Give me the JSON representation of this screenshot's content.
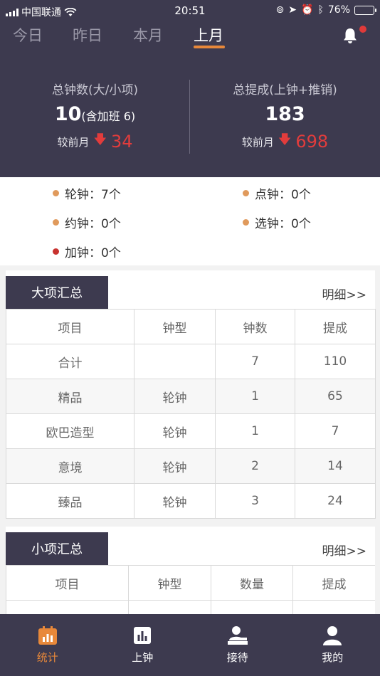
{
  "status_bar": {
    "carrier": "中国联通",
    "time": "20:51",
    "battery": "76%"
  },
  "tabs": [
    {
      "label": "今日"
    },
    {
      "label": "昨日"
    },
    {
      "label": "本月"
    },
    {
      "label": "上月"
    }
  ],
  "active_tab": "上月",
  "summary": {
    "left": {
      "label": "总钟数(大/小项)",
      "value": "10",
      "value_note": "(含加班 6)",
      "compare_label": "较前月",
      "compare_value": "34",
      "direction": "down"
    },
    "right": {
      "label": "总提成(上钟+推销)",
      "value": "183",
      "compare_label": "较前月",
      "compare_value": "698",
      "direction": "down"
    }
  },
  "clock_types": [
    {
      "label": "轮钟：7个",
      "color": "#e09a5c"
    },
    {
      "label": "点钟：0个",
      "color": "#e09a5c"
    },
    {
      "label": "约钟：0个",
      "color": "#e09a5c"
    },
    {
      "label": "选钟：0个",
      "color": "#e09a5c"
    },
    {
      "label": "加钟：0个",
      "color": "#c8322f"
    }
  ],
  "major": {
    "title": "大项汇总",
    "more": "明细>>",
    "headers": [
      "项目",
      "钟型",
      "钟数",
      "提成"
    ],
    "rows": [
      [
        "合计",
        "",
        "7",
        "110"
      ],
      [
        "精品",
        "轮钟",
        "1",
        "65"
      ],
      [
        "欧巴造型",
        "轮钟",
        "1",
        "7"
      ],
      [
        "意境",
        "轮钟",
        "2",
        "14"
      ],
      [
        "臻品",
        "轮钟",
        "3",
        "24"
      ]
    ]
  },
  "minor": {
    "title": "小项汇总",
    "more": "明细>>",
    "headers": [
      "项目",
      "钟型",
      "数量",
      "提成"
    ]
  },
  "bottom_nav": [
    {
      "label": "统计",
      "icon": "stats-icon"
    },
    {
      "label": "上钟",
      "icon": "bar-chart-icon"
    },
    {
      "label": "接待",
      "icon": "reception-icon"
    },
    {
      "label": "我的",
      "icon": "user-icon"
    }
  ],
  "colors": {
    "header_bg": "#3d3a4f",
    "accent": "#e8883a",
    "decrease": "#e23c3c"
  }
}
